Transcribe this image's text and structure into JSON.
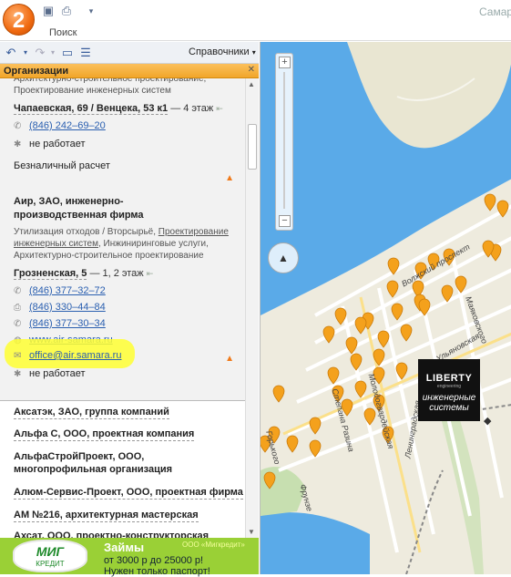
{
  "window": {
    "title": "Самар",
    "search_label": "Поиск",
    "logo_text": "2"
  },
  "toolbar": {
    "back": "back-icon",
    "forward": "forward-icon",
    "reference_dropdown": "Справочники"
  },
  "org_header": {
    "title": "Организации"
  },
  "card1": {
    "categories": "Архитектурно-строительное проектирование, Проектирование инженерных систем",
    "address": "Чапаевская, 69 / Венцека, 53 к1",
    "address_extra": "— 4 этаж",
    "phone": "(846) 242–69–20",
    "hours": "не работает",
    "payment": "Безналичный расчет"
  },
  "card2": {
    "name": "Аир, ЗАО, инженерно-производственная фирма",
    "categories_plain1": "Утилизация отходов / Вторсырьё,",
    "categories_link": "Проектирование инженерных систем",
    "categories_plain2": ", Инжиниринговые услуги, Архитектурно-строительное проектирование",
    "address": "Грозненская, 5",
    "address_extra": "— 1, 2 этаж",
    "phone1": "(846) 377–32–72",
    "fax": "(846) 330–44–84",
    "phone2": "(846) 377–30–34",
    "website": "www.air-samara.ru",
    "email": "office@air.samara.ru",
    "hours": "не работает"
  },
  "list": [
    "Аксатэк, ЗАО, группа компаний",
    "Альфа С, ООО, проектная компания",
    "АльфаСтройПроект, ООО, многопрофильная организация",
    "Алюм-Сервис-Проект, ООО, проектная фирма",
    "АМ №216, архитектурная мастерская",
    "Ахсат, ООО, проектно-конструкторская фирма"
  ],
  "ad": {
    "logo_main": "МИГ",
    "logo_sub": "КРЕДИТ",
    "title": "Займы",
    "company": "ООО «Мигкредит»",
    "line1": "от 3000 р до 25000 р!",
    "line2": "Нужен только паспорт!"
  },
  "map": {
    "streets": [
      "Волжский проспект",
      "Маяковского",
      "Чкалова",
      "Ульяновская",
      "Молодогвардейская",
      "Степана Разина",
      "Горького",
      "Фрунзе",
      "Ленинградская",
      "Пушкина"
    ],
    "billboard": {
      "brand": "LIBERTY",
      "sub": "engineering",
      "line1": "инженерные",
      "line2": "системы"
    },
    "colors": {
      "water": "#5aaae8",
      "land": "#eeebde",
      "marker": "#f4a11c",
      "park": "#c7dfb0"
    }
  }
}
